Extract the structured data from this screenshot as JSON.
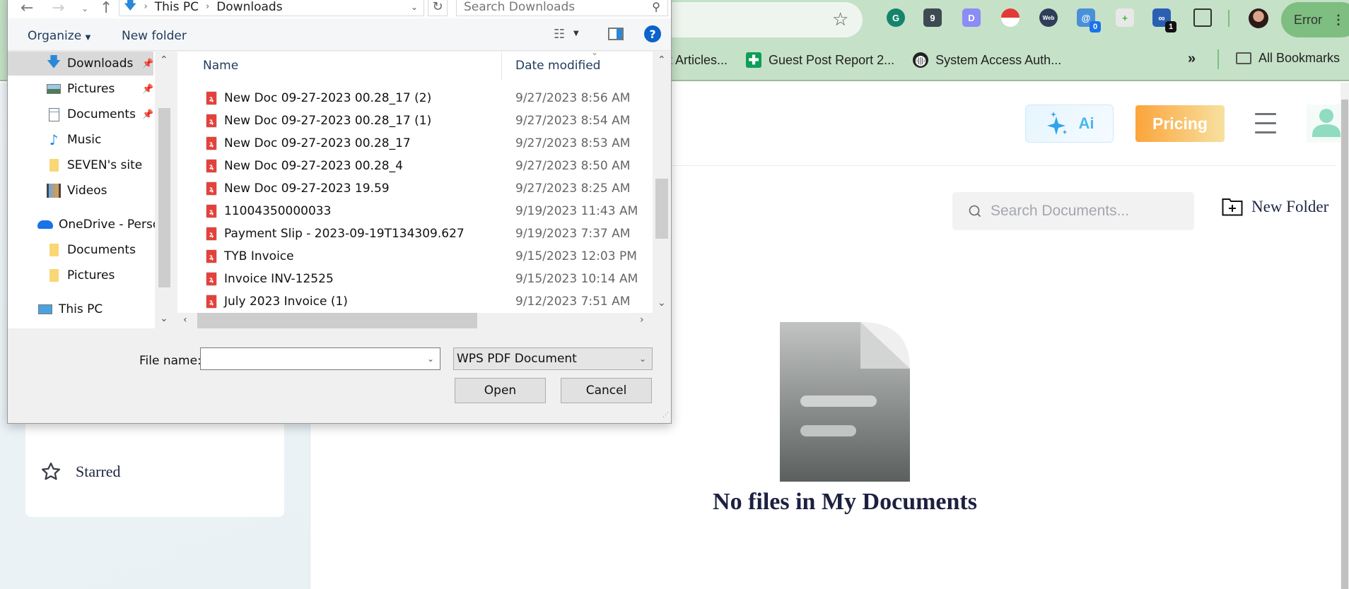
{
  "browser": {
    "extensions": [
      {
        "name": "grammarly",
        "glyph": "G",
        "color": "#15846d"
      },
      {
        "name": "counter",
        "glyph": "9",
        "color": "#3e4a52"
      },
      {
        "name": "d-extension",
        "glyph": "D",
        "color": "#8b8cf5"
      },
      {
        "name": "pokeball",
        "glyph": "",
        "color": "#e53935"
      },
      {
        "name": "webchatgpt",
        "glyph": "Web",
        "color": "#2e3e59"
      },
      {
        "name": "email-extractor",
        "glyph": "@",
        "color": "#4a90d9",
        "badge": "0",
        "badge_color": "#1a73e8"
      },
      {
        "name": "add-extension",
        "glyph": "+",
        "color": "#e8e8e8"
      },
      {
        "name": "link-extension",
        "glyph": "∞",
        "color": "#2b5fb4",
        "badge": "1",
        "badge_color": "#111111"
      }
    ],
    "profile_status": "Error",
    "bookmarks": [
      {
        "label": "t Articles...",
        "icon": "none"
      },
      {
        "label": "Guest Post Report 2...",
        "icon": "sheets-icon"
      },
      {
        "label": "System Access Auth...",
        "icon": "globe-icon"
      }
    ],
    "more_bookmarks": "»",
    "all_bookmarks": "All Bookmarks"
  },
  "page": {
    "ai_button": "Ai",
    "pricing_button": "Pricing",
    "search_placeholder": "Search Documents...",
    "new_folder": "New Folder",
    "sidebar_starred": "Starred",
    "empty_message": "No files in My Documents"
  },
  "dialog": {
    "breadcrumb": [
      "This PC",
      "Downloads"
    ],
    "search_placeholder": "Search Downloads",
    "organize": "Organize",
    "new_folder": "New folder",
    "nav_items": [
      {
        "label": "Downloads",
        "icon": "downloads-icon",
        "pinned": true,
        "selected": true
      },
      {
        "label": "Pictures",
        "icon": "pictures-icon",
        "pinned": true
      },
      {
        "label": "Documents",
        "icon": "documents-icon",
        "pinned": true
      },
      {
        "label": "Music",
        "icon": "music-icon"
      },
      {
        "label": "SEVEN's site",
        "icon": "folder-icon"
      },
      {
        "label": "Videos",
        "icon": "videos-icon"
      },
      {
        "label": "OneDrive - Person",
        "icon": "onedrive-icon"
      },
      {
        "label": "Documents",
        "icon": "folder-icon"
      },
      {
        "label": "Pictures",
        "icon": "folder-icon"
      },
      {
        "label": "This PC",
        "icon": "this-pc-icon"
      }
    ],
    "columns": {
      "name": "Name",
      "date": "Date modified"
    },
    "files": [
      {
        "name": "New Doc 09-27-2023 00.28_17 (2)",
        "date": "9/27/2023 8:56 AM"
      },
      {
        "name": "New Doc 09-27-2023 00.28_17 (1)",
        "date": "9/27/2023 8:54 AM"
      },
      {
        "name": "New Doc 09-27-2023 00.28_17",
        "date": "9/27/2023 8:53 AM"
      },
      {
        "name": "New Doc 09-27-2023 00.28_4",
        "date": "9/27/2023 8:50 AM"
      },
      {
        "name": "New Doc 09-27-2023 19.59",
        "date": "9/27/2023 8:25 AM"
      },
      {
        "name": "11004350000033",
        "date": "9/19/2023 11:43 AM"
      },
      {
        "name": "Payment Slip - 2023-09-19T134309.627",
        "date": "9/19/2023 7:37 AM"
      },
      {
        "name": "TYB Invoice",
        "date": "9/15/2023 12:03 PM"
      },
      {
        "name": "Invoice INV-12525",
        "date": "9/15/2023 10:14 AM"
      },
      {
        "name": "July 2023 Invoice (1)",
        "date": "9/12/2023 7:51 AM"
      }
    ],
    "file_name_label": "File name:",
    "file_name_value": "",
    "file_type": "WPS PDF Document",
    "open_button": "Open",
    "cancel_button": "Cancel"
  }
}
